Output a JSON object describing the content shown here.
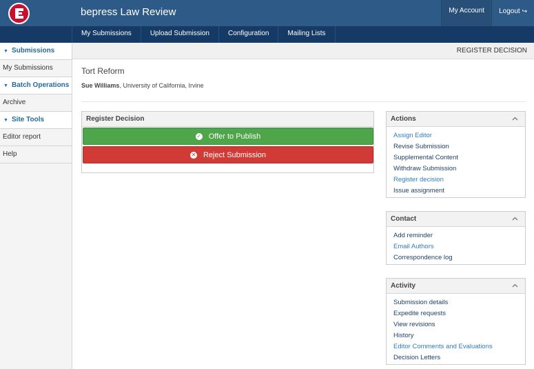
{
  "header": {
    "site_title": "bepress Law Review",
    "my_account": "My Account",
    "logout": "Logout",
    "logo_letter": "E",
    "brand_color": "#2e5a87",
    "logo_color": "#c8102e"
  },
  "nav": {
    "items": [
      "My Submissions",
      "Upload Submission",
      "Configuration",
      "Mailing Lists"
    ]
  },
  "sidebar": {
    "sections": [
      {
        "label": "Submissions",
        "items": [
          "My Submissions"
        ]
      },
      {
        "label": "Batch Operations",
        "items": [
          "Archive"
        ]
      },
      {
        "label": "Site Tools",
        "items": [
          "Editor report",
          "Help"
        ]
      }
    ]
  },
  "page": {
    "strip_label": "REGISTER DECISION",
    "title": "Tort Reform",
    "author_name": "Sue Williams",
    "author_affiliation": ", University of California, Irvine"
  },
  "decision": {
    "heading": "Register Decision",
    "publish_label": "Offer to Publish",
    "reject_label": "Reject Submission",
    "publish_color": "#4ea54a",
    "reject_color": "#d13b36"
  },
  "actions": {
    "heading": "Actions",
    "links": [
      "Assign Editor",
      "Revise Submission",
      "Supplemental Content",
      "Withdraw Submission",
      "Register decision",
      "Issue assignment"
    ]
  },
  "contact": {
    "heading": "Contact",
    "links": [
      "Add reminder",
      "Email Authors",
      "Correspondence log"
    ]
  },
  "activity": {
    "heading": "Activity",
    "links": [
      "Submission details",
      "Expedite requests",
      "View revisions",
      "History",
      "Editor Comments and Evaluations",
      "Decision Letters"
    ]
  }
}
